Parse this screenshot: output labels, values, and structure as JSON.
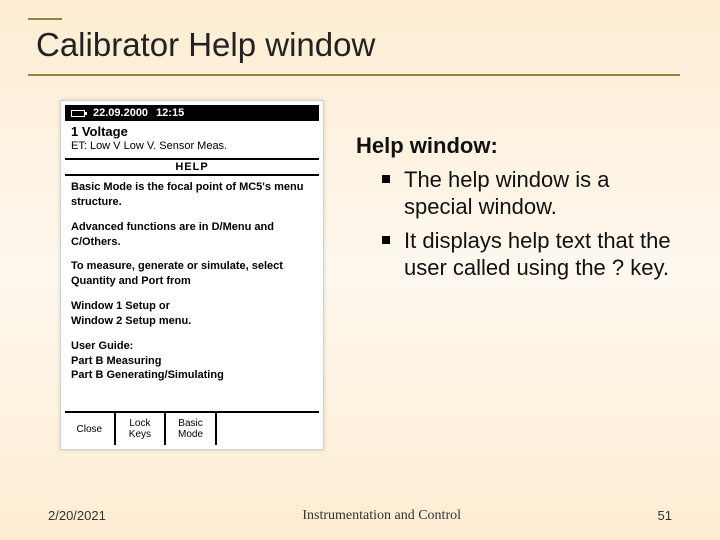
{
  "title": "Calibrator Help window",
  "device": {
    "status": {
      "date": "22.09.2000",
      "time": "12:15"
    },
    "header": {
      "line1": "1   Voltage",
      "line2": "ET: Low V Low V. Sensor Meas."
    },
    "helpLabel": "HELP",
    "body": {
      "p1": "Basic Mode is the focal point of MC5's menu structure.",
      "p2": "Advanced functions are in D/Menu and C/Others.",
      "p3": "To measure, generate or simulate, select Quantity and Port from",
      "p4": "Window 1 Setup or",
      "p5": "Window 2 Setup menu.",
      "p6": "User Guide:",
      "p7": "Part B Measuring",
      "p8": "Part B Generating/Simulating"
    },
    "softKeys": {
      "k1": "Close",
      "k2": "Lock\nKeys",
      "k3": "Basic\nMode",
      "k4": ""
    }
  },
  "right": {
    "heading": "Help window:",
    "items": [
      "The help window is a special window.",
      "It displays help text that the user called using the ? key."
    ]
  },
  "footer": {
    "date": "2/20/2021",
    "center": "Instrumentation and Control",
    "page": "51"
  }
}
